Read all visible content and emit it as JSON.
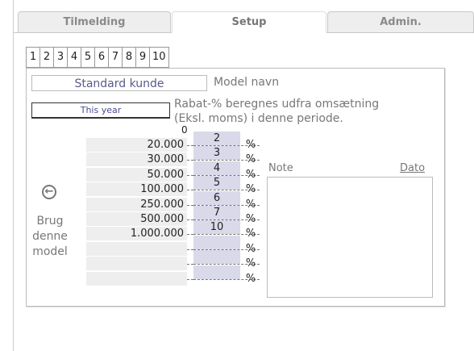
{
  "tabs": [
    "Tilmelding",
    "Setup",
    "Admin."
  ],
  "page_tabs": [
    "1",
    "2",
    "3",
    "4",
    "5",
    "6",
    "7",
    "8",
    "9",
    "10"
  ],
  "customer_name": "Standard kunde",
  "model_name_label": "Model navn",
  "period_button": "This year",
  "period_desc_line1": "Rabat-% beregnes udfra omsætning",
  "period_desc_line2": "(Eksl. moms) i denne periode.",
  "zero_label": "0",
  "thresholds": [
    "20.000",
    "30.000",
    "50.000",
    "100.000",
    "250.000",
    "500.000",
    "1.000.000",
    "",
    "",
    ""
  ],
  "percents": [
    "2",
    "3",
    "4",
    "5",
    "6",
    "7",
    "10",
    "",
    "",
    ""
  ],
  "percent_sign": "%",
  "note_label": "Note",
  "date_label": "Dato",
  "use_model_line1": "Brug",
  "use_model_line2": "denne",
  "use_model_line3": "model"
}
